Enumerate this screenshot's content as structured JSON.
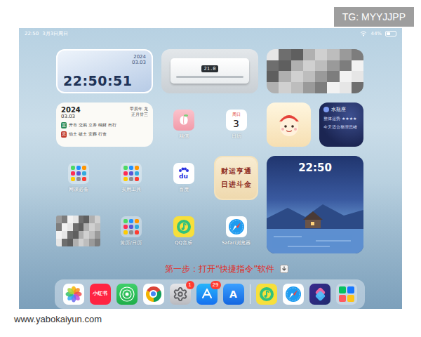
{
  "watermarks": {
    "top": "TG: MYYJJPP",
    "bottom": "www.yabokaiyun.com"
  },
  "status_bar": {
    "time": "22:50",
    "date": "3月3日周日",
    "battery": "44%",
    "battery_level": 0.44
  },
  "clock_widget": {
    "year": "2024",
    "date": "03.03",
    "time": "22:50:51"
  },
  "ac_widget": {
    "temperature": "21.0"
  },
  "calendar_widget": {
    "year": "2024",
    "date": "03.03",
    "ganzhi": "甲辰年 龙",
    "lunar": "正月廿三",
    "lines": [
      {
        "mark": "宜",
        "text": "开市 交易 立券 纳财 出行",
        "color": "#2e8b57"
      },
      {
        "mark": "忌",
        "text": "动土 破土 安葬 行丧",
        "color": "#c0392b"
      }
    ]
  },
  "horoscope_widget": {
    "sign": "水瓶座",
    "lines": [
      "整体运势 ★★★★",
      "今天适合整理思绪"
    ]
  },
  "fortune_widget": {
    "lines": [
      "财运亨通",
      "日进斗金"
    ]
  },
  "night_widget": {
    "time": "22:50"
  },
  "apps": [
    {
      "kind": "peach",
      "label": "精信"
    },
    {
      "kind": "calendar",
      "label": "日历",
      "weekday": "周日",
      "day": "3"
    },
    {
      "kind": "folder",
      "label": "网课必备"
    },
    {
      "kind": "folder",
      "label": "实用工具"
    },
    {
      "kind": "baidu",
      "label": "百度",
      "icon_text": "du"
    },
    {
      "kind": "folder",
      "label": "黄历/日历"
    },
    {
      "kind": "qqmusic",
      "label": "QQ音乐"
    },
    {
      "kind": "safari",
      "label": "Safari浏览器"
    }
  ],
  "instruction": "第一步：打开“快捷指令”软件",
  "dock": {
    "apps": [
      {
        "kind": "photos"
      },
      {
        "kind": "xiaohongshu",
        "icon_text": "小红书"
      },
      {
        "kind": "findmy"
      },
      {
        "kind": "chrome"
      },
      {
        "kind": "settings",
        "badge": "1"
      },
      {
        "kind": "appstore",
        "badge": "29"
      },
      {
        "kind": "translate",
        "icon_text": "A"
      }
    ],
    "recent": [
      {
        "kind": "qqmusic"
      },
      {
        "kind": "safari"
      },
      {
        "kind": "shortcuts"
      },
      {
        "kind": "library"
      }
    ]
  }
}
